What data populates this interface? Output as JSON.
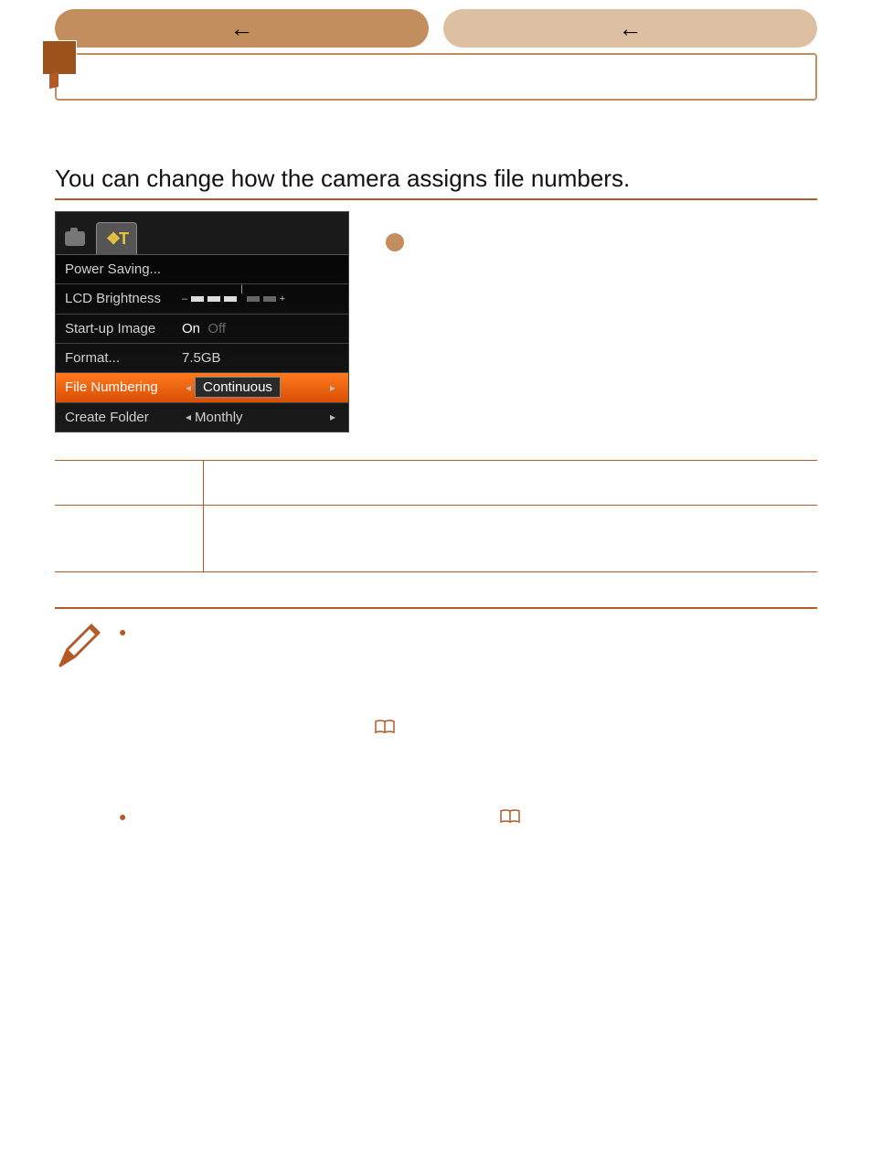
{
  "nav": {
    "left_arrow": "←",
    "right_arrow": "←"
  },
  "intro": "You can change how the camera assigns file numbers.",
  "lcd": {
    "rows": [
      {
        "label": "Power Saving...",
        "value": ""
      },
      {
        "label": "LCD Brightness",
        "value": ""
      },
      {
        "label": "Start-up Image",
        "value_on": "On",
        "value_off": "Off"
      },
      {
        "label": "Format...",
        "value": "7.5GB"
      },
      {
        "label": "File Numbering",
        "value": "Continuous"
      },
      {
        "label": "Create Folder",
        "value": "Monthly"
      }
    ]
  }
}
